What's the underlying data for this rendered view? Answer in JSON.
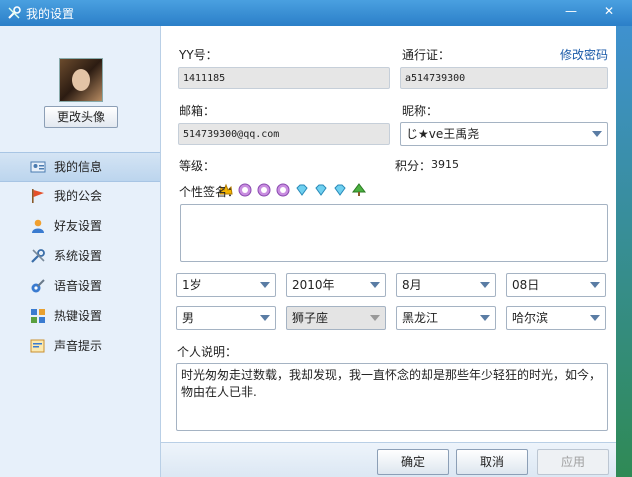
{
  "window": {
    "title": "我的设置",
    "minimize": "—",
    "close": "✕"
  },
  "sidebar": {
    "change_avatar": "更改头像",
    "items": [
      {
        "label": "我的信息",
        "icon": "profile-card-icon",
        "active": true
      },
      {
        "label": "我的公会",
        "icon": "flag-icon"
      },
      {
        "label": "好友设置",
        "icon": "user-icon"
      },
      {
        "label": "系统设置",
        "icon": "tools-icon"
      },
      {
        "label": "语音设置",
        "icon": "mic-icon"
      },
      {
        "label": "热键设置",
        "icon": "keyboard-icon"
      },
      {
        "label": "声音提示",
        "icon": "sound-icon"
      }
    ]
  },
  "form": {
    "yy_label": "YY号：",
    "yy_value": "1411185",
    "pass_label": "通行证：",
    "pass_value": "a514739300",
    "change_password": "修改密码",
    "email_label": "邮箱：",
    "email_value": "514739300@qq.com",
    "nick_label": "昵称：",
    "nick_value": "じ★ve王禹尧",
    "level_label": "等级：",
    "score_label": "积分：",
    "score_value": "3915",
    "sign_label": "个性签名：",
    "sign_value": "",
    "age": "1岁",
    "year": "2010年",
    "month": "8月",
    "day": "08日",
    "gender": "男",
    "zodiac": "狮子座",
    "province": "黑龙江",
    "city": "哈尔滨",
    "desc_label": "个人说明：",
    "desc_value": "时光匆匆走过数载，我却发现，我一直怀念的却是那些年少轻狂的时光，如今，物由在人已非."
  },
  "buttons": {
    "ok": "确定",
    "cancel": "取消",
    "apply": "应用"
  },
  "level_badges": [
    "crown",
    "sun",
    "sun",
    "sun",
    "diamond",
    "diamond",
    "diamond",
    "tree"
  ],
  "colors": {
    "titlebar": "#2b7fc8",
    "link": "#1a5aa8",
    "accent": "#bcd5ee"
  }
}
